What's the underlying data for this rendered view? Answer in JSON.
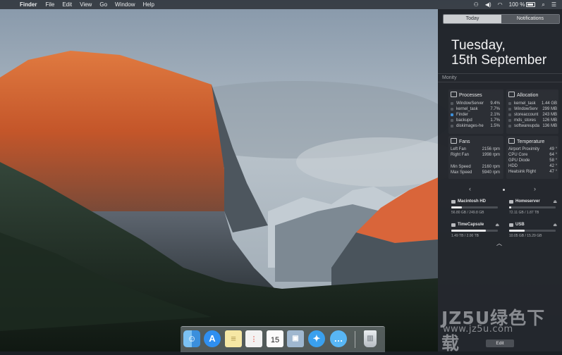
{
  "menubar": {
    "app_name": "Finder",
    "menus": [
      "File",
      "Edit",
      "View",
      "Go",
      "Window",
      "Help"
    ],
    "battery": "100 %"
  },
  "notification_center": {
    "tabs": [
      {
        "label": "Today",
        "active": true
      },
      {
        "label": "Notifications",
        "active": false
      }
    ],
    "date_line1": "Tuesday,",
    "date_line2": "15th September",
    "widget_title": "Monity",
    "processes": {
      "title": "Processes",
      "rows": [
        {
          "name": "WindowServer",
          "value": "9.4%"
        },
        {
          "name": "kernel_task",
          "value": "7.7%"
        },
        {
          "name": "Finder",
          "value": "2.1%"
        },
        {
          "name": "backupd",
          "value": "1.7%"
        },
        {
          "name": "diskimages-he",
          "value": "1.5%"
        }
      ]
    },
    "allocation": {
      "title": "Allocation",
      "rows": [
        {
          "name": "kernel_task",
          "value": "1.44 GB"
        },
        {
          "name": "WindowServ",
          "value": "299 MB"
        },
        {
          "name": "storeaccount",
          "value": "243 MB"
        },
        {
          "name": "mds_stores",
          "value": "126 MB"
        },
        {
          "name": "softwareupda",
          "value": "136 MB"
        }
      ]
    },
    "fans": {
      "title": "Fans",
      "rows": [
        {
          "name": "Left Fan",
          "value": "2156 rpm"
        },
        {
          "name": "Right Fan",
          "value": "1998 rpm"
        },
        {
          "name": "Min Speed",
          "value": "2160 rpm"
        },
        {
          "name": "Max Speed",
          "value": "5940 rpm"
        }
      ]
    },
    "temperature": {
      "title": "Temperature",
      "rows": [
        {
          "name": "Airport Proximity",
          "value": "49 °"
        },
        {
          "name": "CPU Core",
          "value": "64 °"
        },
        {
          "name": "GPU Diode",
          "value": "58 °"
        },
        {
          "name": "HDD",
          "value": "42 °"
        },
        {
          "name": "Heatsink Right",
          "value": "47 °"
        }
      ]
    },
    "disks": [
      {
        "name": "Macintosh HD",
        "size": "56.80 GB / 249.8 GB",
        "fill": 0.23
      },
      {
        "name": "Homeserver",
        "size": "72.11 GB / 1.87 TB",
        "fill": 0.05
      },
      {
        "name": "TimeCapsule",
        "size": "1.49 TB / 2.00 TB",
        "fill": 0.74
      },
      {
        "name": "USB",
        "size": "10.05 GB / 15.29 GB",
        "fill": 0.33
      }
    ],
    "edit_label": "Edit"
  },
  "dock": {
    "apps": [
      "Finder",
      "App Store",
      "Notes",
      "Reminders",
      "Calendar",
      "Preview",
      "Safari",
      "Messages",
      "Trash"
    ],
    "calendar_day": "15"
  },
  "watermark": {
    "line1": "JZ5U绿色下载",
    "line2": "www.jz5u.com"
  }
}
